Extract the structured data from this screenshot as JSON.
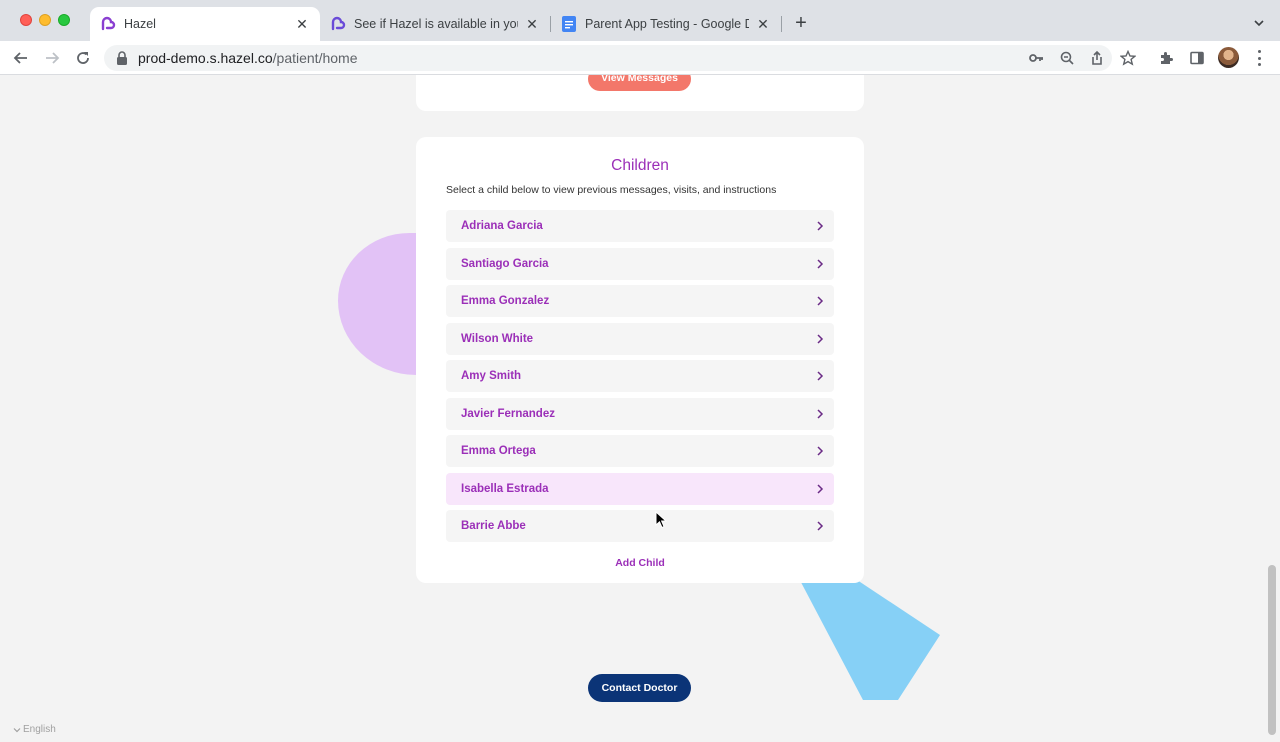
{
  "browser": {
    "tabs": [
      {
        "title": "Hazel",
        "icon": "hazel-logo-icon",
        "active": true
      },
      {
        "title": "See if Hazel is available in your",
        "icon": "hazel-logo-icon",
        "active": false
      },
      {
        "title": "Parent App Testing - Google D",
        "icon": "google-docs-icon",
        "active": false
      }
    ],
    "url_host": "prod-demo.s.hazel.co",
    "url_path": "/patient/home"
  },
  "page": {
    "view_messages_label": "View Messages",
    "children_section": {
      "title": "Children",
      "subtitle": "Select a child below to view previous messages, visits, and instructions",
      "children": [
        {
          "name": "Adriana Garcia"
        },
        {
          "name": "Santiago Garcia"
        },
        {
          "name": "Emma Gonzalez"
        },
        {
          "name": "Wilson White"
        },
        {
          "name": "Amy Smith"
        },
        {
          "name": "Javier Fernandez"
        },
        {
          "name": "Emma Ortega"
        },
        {
          "name": "Isabella Estrada"
        },
        {
          "name": "Barrie Abbe"
        }
      ],
      "add_child_label": "Add Child"
    },
    "contact_doctor_label": "Contact Doctor",
    "language_label": "English"
  },
  "colors": {
    "accent_purple": "#9b2fb8",
    "contact_button": "#0b3477",
    "view_messages_button": "#f3776a"
  }
}
